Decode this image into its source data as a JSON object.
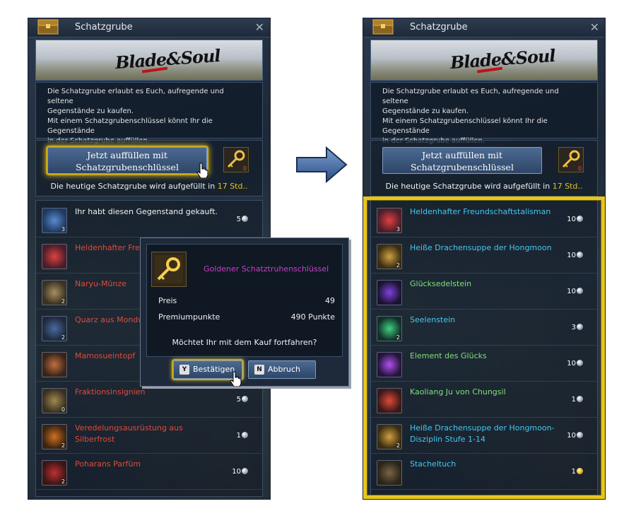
{
  "left_panel": {
    "title": "Schatzgrube",
    "close_glyph": "✕",
    "banner_logo": "Blade&Soul",
    "info_lines": [
      "Die Schatzgrube erlaubt es Euch, aufregende und seltene",
      "Gegenstände zu kaufen.",
      "Mit einem Schatzgrubenschlüssel könnt Ihr die Gegenstände",
      "in der Schatzgrube auffüllen."
    ],
    "fill_button": {
      "line1": "Jetzt auffüllen mit",
      "line2": "Schatzgrubenschlüssel"
    },
    "key_count": "0",
    "refill_text": "Die heutige Schatzgrube wird aufgefüllt in",
    "refill_value": "17  Std..",
    "items": [
      {
        "name": "Ihr habt diesen Gegenstand gekauft.",
        "qty": "3",
        "price": "5",
        "color": "white",
        "icon": "gem-icon"
      },
      {
        "name": "Heldenhafter Freu",
        "qty": "",
        "price": "",
        "color": "red",
        "icon": "talisman-icon"
      },
      {
        "name": "Naryu-Münze",
        "qty": "2",
        "price": "",
        "color": "red",
        "icon": "coin-icon"
      },
      {
        "name": "Quarz aus Mondw",
        "qty": "2",
        "price": "",
        "color": "red",
        "icon": "quartz-icon"
      },
      {
        "name": "Mamosueintopf",
        "qty": "",
        "price": "",
        "color": "red",
        "icon": "stew-icon"
      },
      {
        "name": "Fraktionsinsignien",
        "qty": "0",
        "price": "5",
        "color": "red",
        "icon": "insignia-icon"
      },
      {
        "name": "Veredelungsausrüstung aus Silberfrost",
        "qty": "2",
        "price": "1",
        "color": "red",
        "icon": "upgrade-kit-icon"
      },
      {
        "name": "Poharans Parfüm",
        "qty": "2",
        "price": "10",
        "color": "red",
        "icon": "perfume-icon"
      }
    ]
  },
  "dialog": {
    "item_name": "Goldener Schatztruhenschlüssel",
    "price_label": "Preis",
    "price_value": "49",
    "premium_label": "Premiumpunkte",
    "premium_value": "490 Punkte",
    "question": "Möchtet Ihr mit dem Kauf fortfahren?",
    "confirm_key": "Y",
    "confirm_label": "Bestätigen",
    "cancel_key": "N",
    "cancel_label": "Abbruch"
  },
  "right_panel": {
    "title": "Schatzgrube",
    "close_glyph": "✕",
    "banner_logo": "Blade&Soul",
    "info_lines": [
      "Die Schatzgrube erlaubt es Euch, aufregende und seltene",
      "Gegenstände zu kaufen.",
      "Mit einem Schatzgrubenschlüssel könnt Ihr die Gegenstände",
      "in der Schatzgrube auffüllen."
    ],
    "fill_button": {
      "line1": "Jetzt auffüllen mit",
      "line2": "Schatzgrubenschlüssel"
    },
    "key_count": "0",
    "refill_text": "Die heutige Schatzgrube wird aufgefüllt in",
    "refill_value": "17  Std..",
    "items": [
      {
        "name": "Heldenhafter Freundschaftstalisman",
        "qty": "3",
        "price": "10",
        "color": "cyan",
        "icon": "talisman-icon"
      },
      {
        "name": "Heiße Drachensuppe der Hongmoon",
        "qty": "2",
        "price": "10",
        "color": "cyan",
        "icon": "soup-icon"
      },
      {
        "name": "Glücksedelstein",
        "qty": "",
        "price": "10",
        "color": "green",
        "icon": "luck-gem-icon"
      },
      {
        "name": "Seelenstein",
        "qty": "2",
        "price": "3",
        "color": "cyan",
        "icon": "soulstone-icon"
      },
      {
        "name": "Element des Glücks",
        "qty": "",
        "price": "10",
        "color": "green",
        "icon": "element-icon"
      },
      {
        "name": "Kaoliang Ju von Chungsil",
        "qty": "",
        "price": "1",
        "color": "green",
        "icon": "bottle-icon"
      },
      {
        "name": "Heiße Drachensuppe der Hongmoon-Disziplin Stufe 1-14",
        "qty": "2",
        "price": "10",
        "color": "cyan",
        "icon": "soup-icon"
      },
      {
        "name": "Stacheltuch",
        "qty": "",
        "price": "1",
        "color": "cyan",
        "icon": "cloth-icon",
        "coin": "gold"
      }
    ]
  }
}
